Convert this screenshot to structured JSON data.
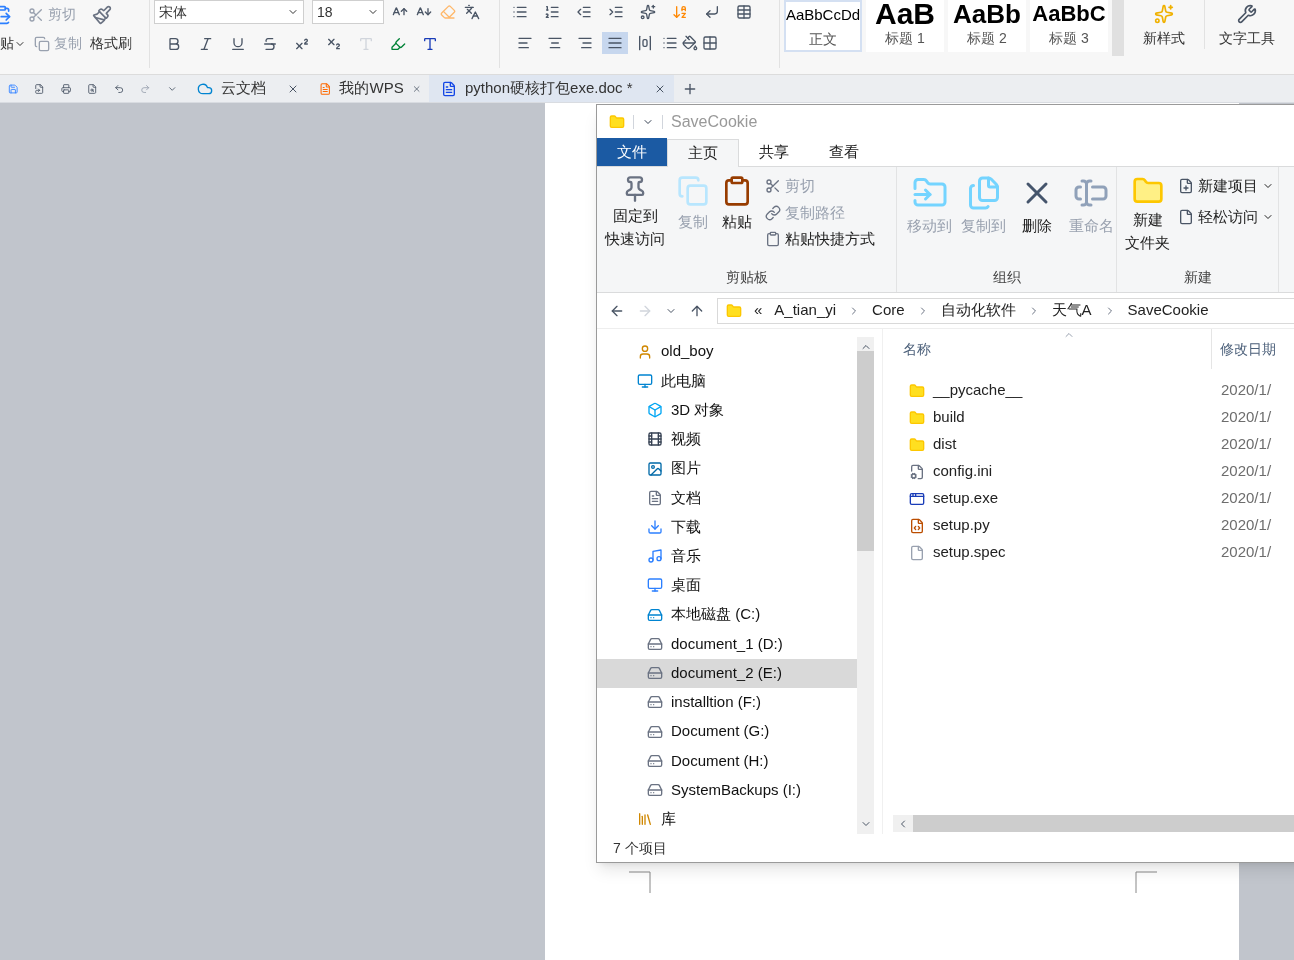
{
  "wps": {
    "clipboard": {
      "paste": "贴",
      "cut": "剪切",
      "copy": "复制",
      "format_painter": "格式刷"
    },
    "font": {
      "family": "宋体",
      "size": "18"
    },
    "align": [
      {
        "selected": false
      },
      {
        "selected": false
      },
      {
        "selected": false
      },
      {
        "selected": true
      },
      {
        "selected": false
      }
    ],
    "styles": [
      {
        "kind": "body",
        "preview": "AaBbCcDd",
        "label": "正文",
        "selected": true
      },
      {
        "kind": "h1",
        "preview": "AaB",
        "label": "标题 1",
        "selected": false
      },
      {
        "kind": "h2",
        "preview": "AaBb",
        "label": "标题 2",
        "selected": false
      },
      {
        "kind": "h3",
        "preview": "AaBbC",
        "label": "标题 3",
        "selected": false
      }
    ],
    "new_style": "新样式",
    "text_tools": "文字工具",
    "tabs": [
      {
        "kind": "cloud",
        "label": "云文档",
        "selected": false
      },
      {
        "kind": "wps",
        "label": "我的WPS",
        "selected": false
      },
      {
        "kind": "doc",
        "label": "python硬核打包exe.doc *",
        "selected": true
      }
    ]
  },
  "explorer": {
    "title": "SaveCookie",
    "ribbon_tabs": [
      {
        "kind": "file",
        "label": "文件",
        "selected": false
      },
      {
        "kind": "tab",
        "label": "主页",
        "selected": true
      },
      {
        "kind": "tab",
        "label": "共享",
        "selected": false
      },
      {
        "kind": "tab",
        "label": "查看",
        "selected": false
      }
    ],
    "clipboard": {
      "name": "剪贴板",
      "pin": [
        "固定到",
        "快速访问"
      ],
      "copy": {
        "label": "复制",
        "disabled": true
      },
      "paste": {
        "label": "粘贴",
        "disabled": false
      },
      "small": [
        {
          "kind": "cut",
          "label": "剪切",
          "disabled": true
        },
        {
          "kind": "copy-path",
          "label": "复制路径",
          "disabled": true
        },
        {
          "kind": "paste-shortcut",
          "label": "粘贴快捷方式",
          "disabled": false
        }
      ]
    },
    "organize": {
      "name": "组织",
      "buttons": [
        {
          "kind": "move",
          "label": "移动到",
          "disabled": true
        },
        {
          "kind": "copyto",
          "label": "复制到",
          "disabled": true
        },
        {
          "kind": "delete",
          "label": "删除",
          "disabled": false
        },
        {
          "kind": "rename",
          "label": "重命名",
          "disabled": true
        }
      ]
    },
    "new": {
      "name": "新建",
      "folder": [
        "新建",
        "文件夹"
      ],
      "small": [
        {
          "kind": "item",
          "label": "新建项目"
        },
        {
          "kind": "access",
          "label": "轻松访问"
        }
      ]
    },
    "breadcrumb": [
      "A_tian_yi",
      "Core",
      "自动化软件",
      "天气A",
      "SaveCookie"
    ],
    "overflow": "«",
    "nav": [
      {
        "kind": "user",
        "label": "old_boy",
        "selected": false
      },
      {
        "kind": "pc",
        "label": "此电脑",
        "selected": false,
        "children": [
          {
            "kind": "cube",
            "label": "3D 对象",
            "selected": false
          },
          {
            "kind": "video",
            "label": "视频",
            "selected": false
          },
          {
            "kind": "pictures",
            "label": "图片",
            "selected": false
          },
          {
            "kind": "docs",
            "label": "文档",
            "selected": false
          },
          {
            "kind": "downloads",
            "label": "下载",
            "selected": false
          },
          {
            "kind": "music",
            "label": "音乐",
            "selected": false
          },
          {
            "kind": "desktop",
            "label": "桌面",
            "selected": false
          },
          {
            "kind": "sysdrive",
            "label": "本地磁盘 (C:)",
            "selected": false
          },
          {
            "kind": "drive",
            "label": "document_1 (D:)",
            "selected": false
          },
          {
            "kind": "drive",
            "label": "document_2 (E:)",
            "selected": true
          },
          {
            "kind": "drive",
            "label": "installtion (F:)",
            "selected": false
          },
          {
            "kind": "drive",
            "label": "Document (G:)",
            "selected": false
          },
          {
            "kind": "drive",
            "label": "Document (H:)",
            "selected": false
          },
          {
            "kind": "drive",
            "label": "SystemBackups (I:)",
            "selected": false
          }
        ]
      },
      {
        "kind": "library",
        "label": "库",
        "selected": false
      }
    ],
    "columns": [
      "名称",
      "修改日期"
    ],
    "files": [
      {
        "kind": "folder",
        "name": "__pycache__",
        "date": "2020/1/"
      },
      {
        "kind": "folder",
        "name": "build",
        "date": "2020/1/"
      },
      {
        "kind": "folder",
        "name": "dist",
        "date": "2020/1/"
      },
      {
        "kind": "config",
        "name": "config.ini",
        "date": "2020/1/"
      },
      {
        "kind": "exe",
        "name": "setup.exe",
        "date": "2020/1/"
      },
      {
        "kind": "py",
        "name": "setup.py",
        "date": "2020/1/"
      },
      {
        "kind": "file",
        "name": "setup.spec",
        "date": "2020/1/"
      }
    ],
    "status": "7 个项目"
  }
}
